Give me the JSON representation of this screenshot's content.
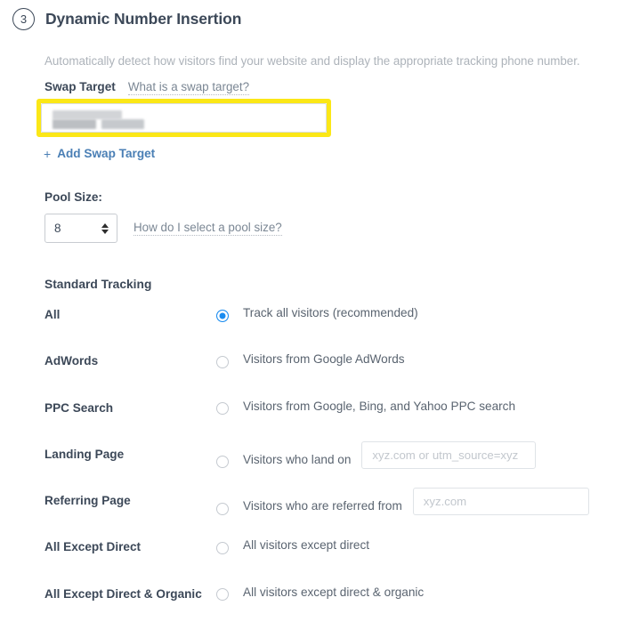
{
  "header": {
    "step_number": "3",
    "title": "Dynamic Number Insertion",
    "description": "Automatically detect how visitors find your website and display the appropriate tracking phone number."
  },
  "swap_target": {
    "label": "Swap Target",
    "help_link": "What is a swap target?",
    "input_value": "",
    "input_redacted": true,
    "highlight_color": "#fbe717",
    "add_link": "Add Swap Target",
    "add_icon": "plus-icon"
  },
  "pool_size": {
    "label": "Pool Size:",
    "value": "8",
    "help_link": "How do I select a pool size?"
  },
  "standard_tracking": {
    "title": "Standard Tracking",
    "accent_color": "#1a8cf0",
    "options": [
      {
        "name": "All",
        "text": "Track all visitors (recommended)",
        "selected": true,
        "input": null
      },
      {
        "name": "AdWords",
        "text": "Visitors from Google AdWords",
        "selected": false,
        "input": null
      },
      {
        "name": "PPC Search",
        "text": "Visitors from Google, Bing, and Yahoo PPC search",
        "selected": false,
        "input": null
      },
      {
        "name": "Landing Page",
        "text": "Visitors who land on",
        "selected": false,
        "input": {
          "placeholder": "xyz.com or utm_source=xyz",
          "value": "",
          "variant": "landing"
        }
      },
      {
        "name": "Referring Page",
        "text": "Visitors who are referred from",
        "selected": false,
        "input": {
          "placeholder": "xyz.com",
          "value": "",
          "variant": "referring"
        }
      },
      {
        "name": "All Except Direct",
        "text": "All visitors except direct",
        "selected": false,
        "input": null
      },
      {
        "name": "All Except Direct & Organic",
        "text": "All visitors except direct & organic",
        "selected": false,
        "input": null
      }
    ]
  }
}
